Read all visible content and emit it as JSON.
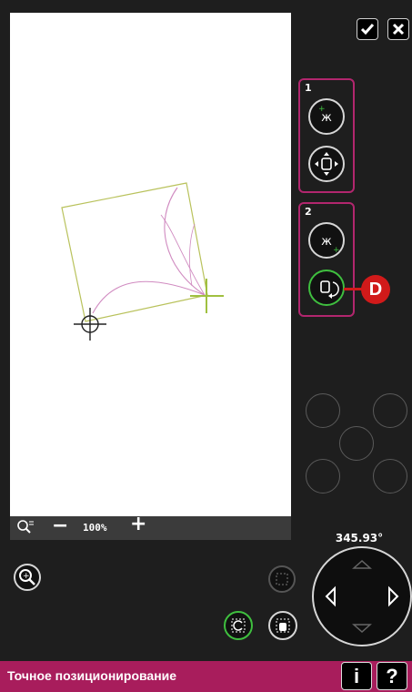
{
  "toolbar": {
    "confirm_icon": "checkmark-icon",
    "close_icon": "close-icon"
  },
  "zoom": {
    "percent": "100%",
    "minus": "−",
    "plus": "+"
  },
  "group1": {
    "number": "1"
  },
  "group2": {
    "number": "2"
  },
  "callout": {
    "label": "D"
  },
  "angle": {
    "value": "345.93°"
  },
  "footer": {
    "title": "Точное позиционирование",
    "info_label": "i",
    "help_label": "?"
  },
  "colors": {
    "accent": "#a81d5c",
    "active_green": "#3fbf3f",
    "callout_red": "#d11a1a"
  }
}
